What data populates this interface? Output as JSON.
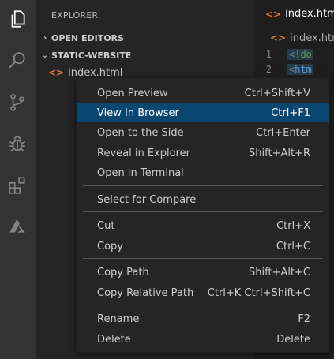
{
  "activity_bar": {
    "icons": [
      "files-icon",
      "search-icon",
      "source-control-icon",
      "debug-icon",
      "extensions-icon",
      "azure-icon"
    ]
  },
  "sidebar": {
    "title": "EXPLORER",
    "sections": [
      {
        "label": "OPEN EDITORS",
        "chevron": "›"
      },
      {
        "label": "STATIC-WEBSITE",
        "chevron": "⌄"
      }
    ],
    "file": {
      "icon_text": "<>",
      "label": "index.html"
    }
  },
  "editor": {
    "tab_label": "index.html",
    "breadcrumb": "index.html",
    "icon_text": "<>",
    "lines": [
      {
        "num": "1",
        "text_open": "<!",
        "text_rest": "do"
      },
      {
        "num": "2",
        "text_open": "<",
        "text_rest": "htm"
      }
    ]
  },
  "context_menu": {
    "groups": [
      [
        {
          "label": "Open Preview",
          "key": "Ctrl+Shift+V"
        },
        {
          "label": "View In Browser",
          "key": "Ctrl+F1",
          "selected": true
        },
        {
          "label": "Open to the Side",
          "key": "Ctrl+Enter"
        },
        {
          "label": "Reveal in Explorer",
          "key": "Shift+Alt+R"
        },
        {
          "label": "Open in Terminal",
          "key": ""
        }
      ],
      [
        {
          "label": "Select for Compare",
          "key": ""
        }
      ],
      [
        {
          "label": "Cut",
          "key": "Ctrl+X"
        },
        {
          "label": "Copy",
          "key": "Ctrl+C"
        }
      ],
      [
        {
          "label": "Copy Path",
          "key": "Shift+Alt+C"
        },
        {
          "label": "Copy Relative Path",
          "key": "Ctrl+K Ctrl+Shift+C"
        }
      ],
      [
        {
          "label": "Rename",
          "key": "F2"
        },
        {
          "label": "Delete",
          "key": "Delete"
        }
      ]
    ]
  },
  "colors": {
    "accent_selected": "#094771",
    "html_icon": "#e37933"
  }
}
